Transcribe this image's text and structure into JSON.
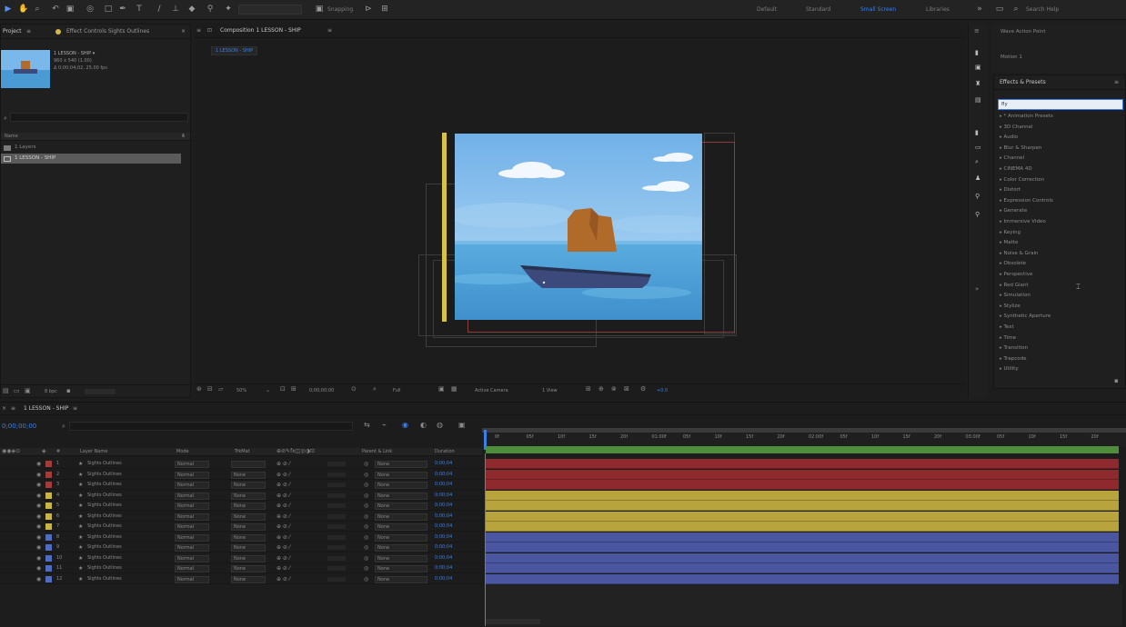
{
  "toolbar": {
    "snapping_label": "Snapping",
    "workspaces": [
      "Default",
      "Standard",
      "Small Screen",
      "Libraries"
    ],
    "active_workspace": "Small Screen",
    "search_placeholder": "Search Help"
  },
  "project_panel": {
    "tabs": [
      "Project",
      "Effect Controls Sights Outlines"
    ],
    "preview_info": [
      "1 LESSON - SHIP ▾",
      "960 x 540 (1.00)",
      "Δ 0;00;04;02, 25.00 fps"
    ],
    "search_placeholder": "",
    "column_header": "Name",
    "items": [
      {
        "name": "1 Layers",
        "selected": false
      },
      {
        "name": "1 LESSON - SHIP",
        "selected": true
      }
    ],
    "bpc": "8 bpc"
  },
  "composition_panel": {
    "tab_label": "Composition 1 LESSON - SHIP",
    "breadcrumb": "1 LESSON - SHIP",
    "zoom": "50%",
    "timecode": "0;00;00;00",
    "resolution": "Full",
    "camera": "Active Camera",
    "views": "1 View",
    "offset": "+0.0"
  },
  "right_panel": {
    "top_labels": [
      "Wave Action Point",
      "Motion 1"
    ],
    "effects_title": "Effects & Presets",
    "search_value": "fly",
    "categories": [
      "* Animation Presets",
      "3D Channel",
      "Audio",
      "Blur & Sharpen",
      "Channel",
      "CINEMA 4D",
      "Color Correction",
      "Distort",
      "Expression Controls",
      "Generate",
      "Immersive Video",
      "Keying",
      "Matte",
      "Noise & Grain",
      "Obsolete",
      "Perspective",
      "Red Giant",
      "Simulation",
      "Stylize",
      "Synthetic Aperture",
      "Text",
      "Time",
      "Transition",
      "Trapcode",
      "Utility"
    ]
  },
  "timeline": {
    "tab_label": "1 LESSON - SHIP",
    "timecode": "0;00;00;00",
    "columns": [
      "Layer Name",
      "Mode",
      "TrkMat",
      "Parent & Link",
      "Duration"
    ],
    "layers": [
      {
        "num": "1",
        "name": "Sights Outlines",
        "color": "#a33b3b",
        "mode": "Normal",
        "trkmat": "",
        "parent": "None",
        "duration": "0;00;04"
      },
      {
        "num": "2",
        "name": "Sights Outlines",
        "color": "#a33b3b",
        "mode": "Normal",
        "trkmat": "None",
        "parent": "None",
        "duration": "0;00;04"
      },
      {
        "num": "3",
        "name": "Sights Outlines",
        "color": "#a33b3b",
        "mode": "Normal",
        "trkmat": "None",
        "parent": "None",
        "duration": "0;00;04"
      },
      {
        "num": "4",
        "name": "Sights Outlines",
        "color": "#c9b544",
        "mode": "Normal",
        "trkmat": "None",
        "parent": "None",
        "duration": "0;00;04"
      },
      {
        "num": "5",
        "name": "Sights Outlines",
        "color": "#c9b544",
        "mode": "Normal",
        "trkmat": "None",
        "parent": "None",
        "duration": "0;00;04"
      },
      {
        "num": "6",
        "name": "Sights Outlines",
        "color": "#c9b544",
        "mode": "Normal",
        "trkmat": "None",
        "parent": "None",
        "duration": "0;00;04"
      },
      {
        "num": "7",
        "name": "Sights Outlines",
        "color": "#c9b544",
        "mode": "Normal",
        "trkmat": "None",
        "parent": "None",
        "duration": "0;00;04"
      },
      {
        "num": "8",
        "name": "Sights Outlines",
        "color": "#4f6dc0",
        "mode": "Normal",
        "trkmat": "None",
        "parent": "None",
        "duration": "0;00;04"
      },
      {
        "num": "9",
        "name": "Sights Outlines",
        "color": "#4f6dc0",
        "mode": "Normal",
        "trkmat": "None",
        "parent": "None",
        "duration": "0;00;04"
      },
      {
        "num": "10",
        "name": "Sights Outlines",
        "color": "#4f6dc0",
        "mode": "Normal",
        "trkmat": "None",
        "parent": "None",
        "duration": "0;00;04"
      },
      {
        "num": "11",
        "name": "Sights Outlines",
        "color": "#4f6dc0",
        "mode": "Normal",
        "trkmat": "None",
        "parent": "None",
        "duration": "0;00;04"
      },
      {
        "num": "12",
        "name": "Sights Outlines",
        "color": "#4f6dc0",
        "mode": "Normal",
        "trkmat": "None",
        "parent": "None",
        "duration": "0;00;04"
      }
    ],
    "ruler_ticks": [
      "0f",
      "05f",
      "10f",
      "15f",
      "20f",
      "01:00f",
      "05f",
      "10f",
      "15f",
      "20f",
      "02:00f",
      "05f",
      "10f",
      "15f",
      "20f",
      "03:00f",
      "05f",
      "10f",
      "15f",
      "20f"
    ],
    "colors": {
      "red": "#8e2a2e",
      "yellow": "#b8a43c",
      "blue": "#4a57a0",
      "green": "#4d8d3c"
    }
  },
  "colors": {
    "accent": "#3d7fe6",
    "panel": "#1f1f1f",
    "sky": "#7ab7ea",
    "sea": "#4a9bd4"
  }
}
